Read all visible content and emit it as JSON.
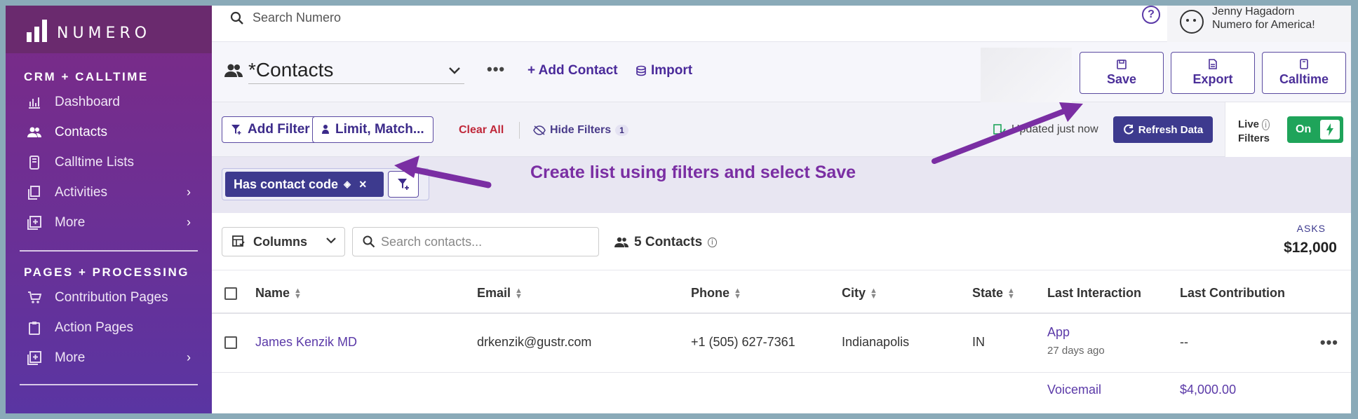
{
  "app": {
    "logo_text": "NUMERO"
  },
  "sidebar": {
    "section1_title": "CRM + CALLTIME",
    "section1_items": [
      {
        "label": "Dashboard",
        "icon": "chart-icon"
      },
      {
        "label": "Contacts",
        "icon": "people-icon"
      },
      {
        "label": "Calltime Lists",
        "icon": "phone-list-icon"
      },
      {
        "label": "Activities",
        "icon": "copy-icon"
      },
      {
        "label": "More",
        "icon": "plus-box-icon"
      }
    ],
    "section2_title": "PAGES + PROCESSING",
    "section2_items": [
      {
        "label": "Contribution Pages",
        "icon": "cart-icon"
      },
      {
        "label": "Action Pages",
        "icon": "clipboard-icon"
      },
      {
        "label": "More",
        "icon": "plus-box-icon"
      }
    ]
  },
  "topbar": {
    "search_placeholder": "Search Numero",
    "user_name": "Jenny Hagadorn",
    "user_org": "Numero for America!"
  },
  "header": {
    "list_name": "*Contacts",
    "add_contact": "+ Add Contact",
    "import": "Import",
    "save": "Save",
    "export": "Export",
    "calltime": "Calltime"
  },
  "filters": {
    "add_filter": "Add Filter",
    "limit_match": "Limit, Match...",
    "clear_all": "Clear All",
    "hide_filters": "Hide Filters",
    "hide_filters_count": "1",
    "updated": "Updated just now",
    "refresh": "Refresh Data",
    "live_filters": "Live\nFilters",
    "live_line1": "Live",
    "live_line2": "Filters",
    "toggle_state": "On",
    "chip_label": "Has contact code"
  },
  "annotation": "Create list using filters and select Save",
  "toolbar": {
    "columns": "Columns",
    "search_placeholder": "Search contacts...",
    "count": "5 Contacts",
    "asks_label": "ASKS",
    "asks_value": "$12,000"
  },
  "table": {
    "headers": [
      "Name",
      "Email",
      "Phone",
      "City",
      "State",
      "Last Interaction",
      "Last Contribution"
    ],
    "rows": [
      {
        "name": "James Kenzik MD",
        "email": "drkenzik@gustr.com",
        "phone": "+1 (505) 627-7361",
        "city": "Indianapolis",
        "state": "IN",
        "last_interaction": "App",
        "last_interaction_time": "27 days ago",
        "last_contribution": "--"
      },
      {
        "last_interaction": "Voicemail",
        "last_contribution": "$4,000.00"
      }
    ]
  },
  "colors": {
    "sidebar_top": "#7b2a86",
    "sidebar_bottom": "#5a35a2",
    "accent": "#3d3a8e",
    "annotation": "#7a2ea3",
    "toggle_on": "#1fa45a",
    "danger": "#c0283a"
  }
}
